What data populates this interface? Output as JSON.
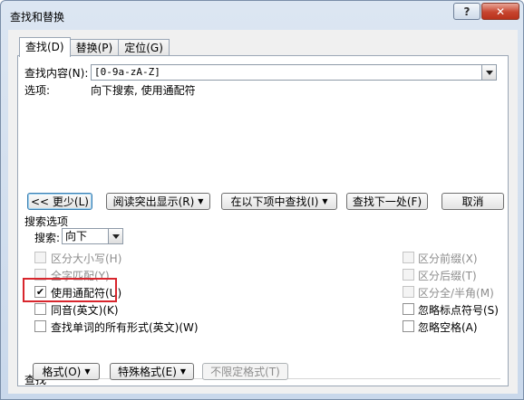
{
  "window": {
    "title": "查找和替换"
  },
  "tabs": [
    {
      "label": "查找(D)"
    },
    {
      "label": "替换(P)"
    },
    {
      "label": "定位(G)"
    }
  ],
  "find": {
    "label": "查找内容(N):",
    "value": "[0-9a-zA-Z]",
    "options_label": "选项:",
    "options_value": "向下搜索, 使用通配符"
  },
  "buttons": {
    "less": "<< 更少(L)",
    "reading_highlight": "阅读突出显示(R)",
    "find_in": "在以下项中查找(I)",
    "find_next": "查找下一处(F)",
    "cancel": "取消"
  },
  "search_options": {
    "header": "搜索选项",
    "search_label": "搜索:",
    "search_value": "向下",
    "left": [
      {
        "label": "区分大小写(H)",
        "checked": false,
        "disabled": true
      },
      {
        "label": "全字匹配(Y)",
        "checked": false,
        "disabled": true
      },
      {
        "label": "使用通配符(U)",
        "checked": true,
        "disabled": false
      },
      {
        "label": "同音(英文)(K)",
        "checked": false,
        "disabled": false
      },
      {
        "label": "查找单词的所有形式(英文)(W)",
        "checked": false,
        "disabled": false
      }
    ],
    "right": [
      {
        "label": "区分前缀(X)",
        "checked": false,
        "disabled": true
      },
      {
        "label": "区分后缀(T)",
        "checked": false,
        "disabled": true
      },
      {
        "label": "区分全/半角(M)",
        "checked": false,
        "disabled": true
      },
      {
        "label": "忽略标点符号(S)",
        "checked": false,
        "disabled": false
      },
      {
        "label": "忽略空格(A)",
        "checked": false,
        "disabled": false
      }
    ]
  },
  "find_section": {
    "header": "查找",
    "format": "格式(O)",
    "special": "特殊格式(E)",
    "no_format": "不限定格式(T)"
  },
  "colors": {
    "highlight": "#d8262d",
    "close": "#c7452f"
  }
}
